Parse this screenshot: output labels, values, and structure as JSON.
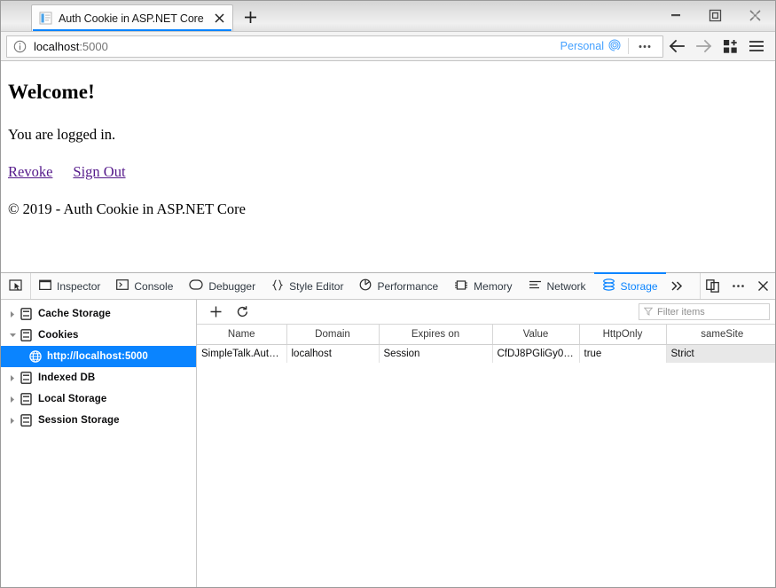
{
  "window": {
    "minimize_label": "Minimize",
    "restore_label": "Restore",
    "close_label": "Close"
  },
  "tabbar": {
    "tabs": [
      {
        "title": "Auth Cookie in ASP.NET Core",
        "favicon": "document-icon",
        "active": true
      }
    ],
    "new_tab_label": "+"
  },
  "navbar": {
    "identity_icon": "info-circle-icon",
    "url_host": "localhost",
    "url_port": ":5000",
    "url_full": "localhost:5000",
    "persona_label": "Personal",
    "persona_icon": "fingerprint-icon",
    "page_actions_icon": "ellipsis-icon",
    "back_icon": "arrow-left-icon",
    "forward_icon": "arrow-right-icon",
    "extensions_icon": "grid-plus-icon",
    "menu_icon": "hamburger-icon"
  },
  "page": {
    "heading": "Welcome!",
    "paragraph": "You are logged in.",
    "links": [
      {
        "label": "Revoke"
      },
      {
        "label": "Sign Out"
      }
    ],
    "footer": "© 2019 - Auth Cookie in ASP.NET Core"
  },
  "devtools": {
    "picker_icon": "element-picker-icon",
    "tabs": [
      {
        "label": "Inspector",
        "icon": "inspector-icon",
        "active": false
      },
      {
        "label": "Console",
        "icon": "console-icon",
        "active": false
      },
      {
        "label": "Debugger",
        "icon": "debugger-icon",
        "active": false
      },
      {
        "label": "Style Editor",
        "icon": "braces-icon",
        "active": false
      },
      {
        "label": "Performance",
        "icon": "performance-icon",
        "active": false
      },
      {
        "label": "Memory",
        "icon": "memory-icon",
        "active": false
      },
      {
        "label": "Network",
        "icon": "network-icon",
        "active": false
      },
      {
        "label": "Storage",
        "icon": "storage-icon",
        "active": true
      }
    ],
    "overflow_icon": "chevron-double-right-icon",
    "responsive_icon": "responsive-design-mode-icon",
    "meatball_icon": "ellipsis-icon",
    "close_icon": "close-icon",
    "accent_color": "#0b84ff",
    "selection_color": "#0a84ff",
    "sidebar": {
      "items": [
        {
          "label": "Cache Storage",
          "icon": "storage-type-icon",
          "expanded": false,
          "selected": false,
          "child": false
        },
        {
          "label": "Cookies",
          "icon": "storage-type-icon",
          "expanded": true,
          "selected": false,
          "child": false
        },
        {
          "label": "http://localhost:5000",
          "icon": "globe-icon",
          "expanded": null,
          "selected": true,
          "child": true
        },
        {
          "label": "Indexed DB",
          "icon": "storage-type-icon",
          "expanded": false,
          "selected": false,
          "child": false
        },
        {
          "label": "Local Storage",
          "icon": "storage-type-icon",
          "expanded": false,
          "selected": false,
          "child": false
        },
        {
          "label": "Session Storage",
          "icon": "storage-type-icon",
          "expanded": false,
          "selected": false,
          "child": false
        }
      ]
    },
    "subtoolbar": {
      "add_icon": "plus-icon",
      "refresh_icon": "refresh-icon",
      "filter_icon": "funnel-icon",
      "filter_placeholder": "Filter items"
    },
    "table": {
      "columns": [
        "Name",
        "Domain",
        "Expires on",
        "Value",
        "HttpOnly",
        "sameSite"
      ],
      "rows": [
        {
          "Name": "SimpleTalk.Auth…",
          "Domain": "localhost",
          "Expires on": "Session",
          "Value": "CfDJ8PGliGy0m…",
          "HttpOnly": "true",
          "sameSite": "Strict"
        }
      ],
      "selected_column": "sameSite"
    }
  }
}
